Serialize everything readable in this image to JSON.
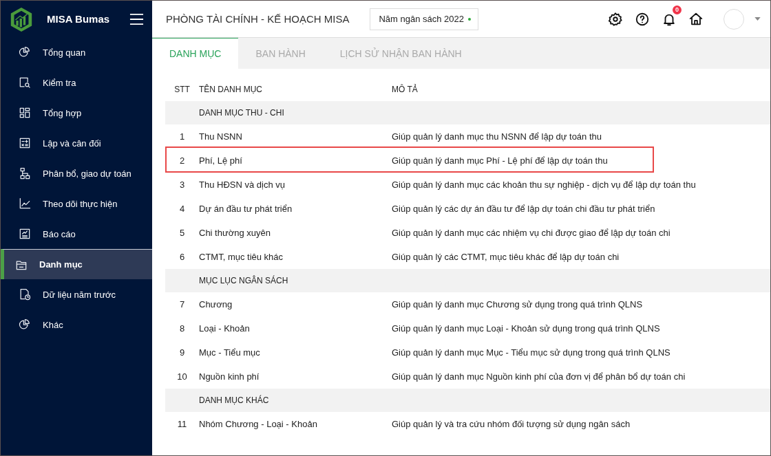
{
  "app": {
    "name": "MISA Bumas"
  },
  "sidebar": {
    "items": [
      {
        "label": "Tổng quan",
        "kind": "pie",
        "selected": false
      },
      {
        "label": "Kiểm tra",
        "kind": "inspect",
        "selected": false
      },
      {
        "label": "Tổng hợp",
        "kind": "grid",
        "selected": false
      },
      {
        "label": "Lập và cân đối",
        "kind": "calc",
        "selected": false
      },
      {
        "label": "Phân bổ, giao dự toán",
        "kind": "tree",
        "selected": false
      },
      {
        "label": "Theo dõi thực hiện",
        "kind": "chart",
        "selected": false
      },
      {
        "label": "Báo cáo",
        "kind": "report",
        "selected": false
      },
      {
        "label": "Danh mục",
        "kind": "folder",
        "selected": true
      },
      {
        "label": "Dữ liệu năm trước",
        "kind": "history",
        "selected": false
      },
      {
        "label": "Khác",
        "kind": "pie",
        "selected": false
      }
    ]
  },
  "header": {
    "title": "PHÒNG TÀI CHÍNH - KẾ HOẠCH MISA",
    "year_selector": "Năm ngân sách 2022",
    "notification_count": "0"
  },
  "tabs": [
    {
      "label": "DANH MỤC",
      "selected": true
    },
    {
      "label": "BAN HÀNH",
      "selected": false
    },
    {
      "label": "LỊCH SỬ NHẬN BAN HÀNH",
      "selected": false
    }
  ],
  "table": {
    "columns": [
      "STT",
      "TÊN DANH MỤC",
      "MÔ TẢ"
    ],
    "rows": [
      {
        "kind": "group",
        "name": "DANH MỤC THU - CHI"
      },
      {
        "kind": "item",
        "stt": "1",
        "name": "Thu NSNN",
        "description": "Giúp quản lý danh mục thu NSNN để lập dự toán thu",
        "highlighted": false
      },
      {
        "kind": "item",
        "stt": "2",
        "name": "Phí, Lệ phí",
        "description": "Giúp quản lý danh mục Phí - Lệ phí để lập dự toán thu",
        "highlighted": true
      },
      {
        "kind": "item",
        "stt": "3",
        "name": "Thu HĐSN và dịch vụ",
        "description": "Giúp quản lý danh mục các khoản thu sự nghiệp - dịch vụ để lập dự toán thu",
        "highlighted": false
      },
      {
        "kind": "item",
        "stt": "4",
        "name": "Dự án đầu tư phát triển",
        "description": "Giúp quản lý các dự án đầu tư để lập dự toán chi đầu tư phát triển",
        "highlighted": false
      },
      {
        "kind": "item",
        "stt": "5",
        "name": "Chi thường xuyên",
        "description": "Giúp quản lý danh mục các nhiệm vụ chi được giao để lập dự toán chi",
        "highlighted": false
      },
      {
        "kind": "item",
        "stt": "6",
        "name": "CTMT, mục tiêu khác",
        "description": "Giúp quản lý các CTMT, mục tiêu khác để lập dự toán chi",
        "highlighted": false
      },
      {
        "kind": "group",
        "name": "MỤC LỤC NGÂN SÁCH"
      },
      {
        "kind": "item",
        "stt": "7",
        "name": "Chương",
        "description": "Giúp quản lý danh mục Chương sử dụng trong quá trình QLNS",
        "highlighted": false
      },
      {
        "kind": "item",
        "stt": "8",
        "name": "Loại - Khoản",
        "description": "Giúp quản lý danh mục Loại - Khoản sử dụng trong quá trình QLNS",
        "highlighted": false
      },
      {
        "kind": "item",
        "stt": "9",
        "name": "Mục - Tiểu mục",
        "description": "Giúp quản lý danh mục Mục - Tiểu mục sử dụng trong quá trình QLNS",
        "highlighted": false
      },
      {
        "kind": "item",
        "stt": "10",
        "name": "Nguồn kinh phí",
        "description": "Giúp quản lý danh mục Nguồn kinh phí của đơn vị để phân bổ dự toán chi",
        "highlighted": false
      },
      {
        "kind": "group",
        "name": "DANH MỤC KHÁC"
      },
      {
        "kind": "item",
        "stt": "11",
        "name": "Nhóm Chương - Loại - Khoản",
        "description": "Giúp quản lý và tra cứu nhóm đối tượng sử dụng ngân sách",
        "highlighted": false
      }
    ]
  }
}
